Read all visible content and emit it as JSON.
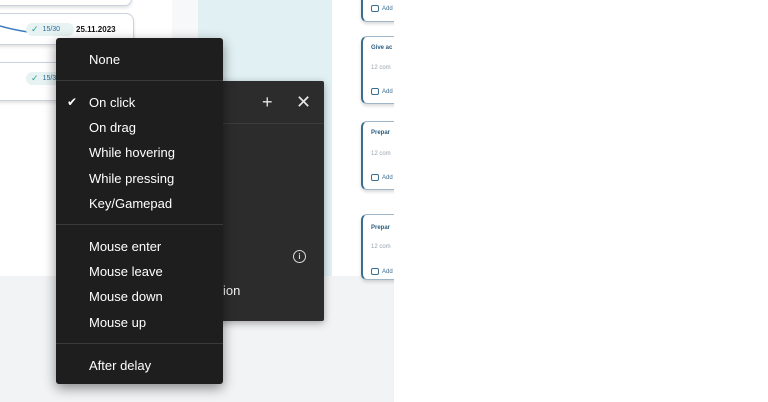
{
  "left_cards": {
    "top_pill": {
      "count": "15/30",
      "date": "25.11.2023"
    },
    "bottom_pill": {
      "count": "15/30"
    }
  },
  "right_cards": [
    {
      "title": "",
      "sub": "",
      "add": "Add"
    },
    {
      "title": "Give ac",
      "sub": "12 com",
      "add": "Add"
    },
    {
      "title": "Prepar",
      "sub": "12 com",
      "add": "Add"
    },
    {
      "title": "Prepar",
      "sub": "12 com",
      "add": "Add"
    }
  ],
  "panel": {
    "icons": [
      "plus-icon",
      "close-icon",
      "info-icon"
    ],
    "partial_label": "sition"
  },
  "menu": {
    "none": "None",
    "triggers": [
      "On click",
      "On drag",
      "While hovering",
      "While pressing",
      "Key/Gamepad"
    ],
    "selected": "On click",
    "mouse_events": [
      "Mouse enter",
      "Mouse leave",
      "Mouse down",
      "Mouse up"
    ],
    "after_delay": "After delay"
  },
  "colors": {
    "menu_bg": "#1e1e1e",
    "panel_bg": "#2c2c2c",
    "accent_teal": "#2a9d8f"
  }
}
